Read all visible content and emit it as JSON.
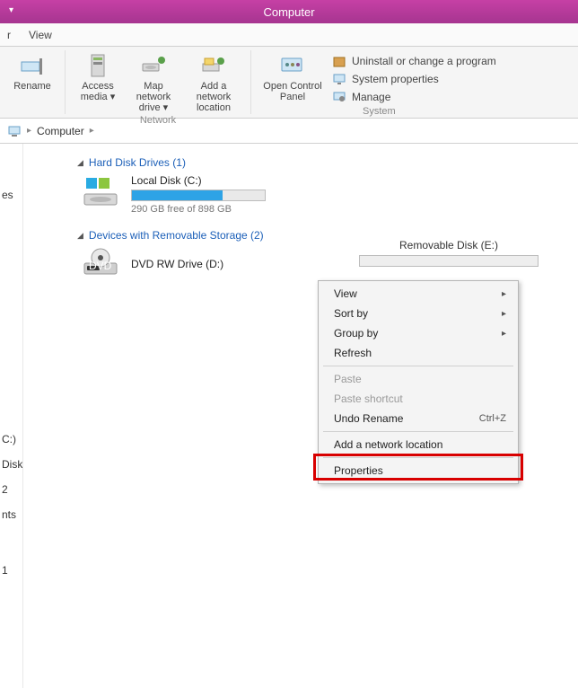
{
  "titlebar": {
    "title": "Computer"
  },
  "menubar": {
    "items": [
      "r",
      "View"
    ]
  },
  "ribbon": {
    "buttons": {
      "rename": "Rename",
      "access_media": "Access media ▾",
      "map_network": "Map network drive ▾",
      "add_network": "Add a network location",
      "open_control": "Open Control Panel"
    },
    "groups": {
      "network": "Network",
      "system": "System"
    },
    "system_items": {
      "uninstall": "Uninstall or change a program",
      "sysprops": "System properties",
      "manage": "Manage"
    }
  },
  "address": {
    "location": "Computer",
    "chev": "▸"
  },
  "sections": {
    "hdd": {
      "label": "Hard Disk Drives (1)"
    },
    "devices": {
      "label": "Devices with Removable Storage (2)"
    }
  },
  "drives": {
    "local": {
      "name": "Local Disk (C:)",
      "free": "290 GB free of 898 GB",
      "fill_pct": 68
    },
    "dvd": {
      "name": "DVD RW Drive (D:)"
    },
    "removable": {
      "name": "Removable Disk (E:)"
    }
  },
  "sidebar": {
    "items": [
      "es",
      "C:)",
      "Disk (E:)",
      "2",
      "nts",
      "1"
    ]
  },
  "context_menu": {
    "view": "View",
    "sortby": "Sort by",
    "groupby": "Group by",
    "refresh": "Refresh",
    "paste": "Paste",
    "paste_shortcut": "Paste shortcut",
    "undo_rename": "Undo Rename",
    "undo_shortcut": "Ctrl+Z",
    "add_network": "Add a network location",
    "properties": "Properties"
  }
}
